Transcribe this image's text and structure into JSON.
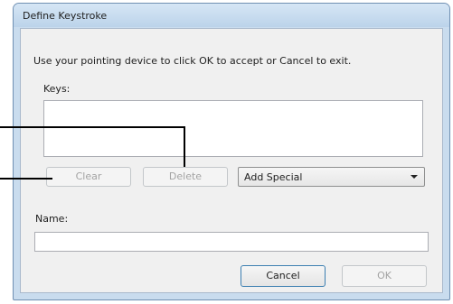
{
  "window": {
    "title": "Define Keystroke",
    "instruction": "Use your pointing device to click OK to accept or Cancel to exit."
  },
  "keys": {
    "label": "Keys:",
    "value": ""
  },
  "buttons": {
    "clear": "Clear",
    "delete": "Delete",
    "cancel": "Cancel",
    "ok": "OK"
  },
  "add_special": {
    "selected": "Add Special"
  },
  "name": {
    "label": "Name:",
    "value": ""
  },
  "colors": {
    "frame": "#c9dcee",
    "client": "#f0f0f0",
    "callout_lines": "#000000"
  }
}
